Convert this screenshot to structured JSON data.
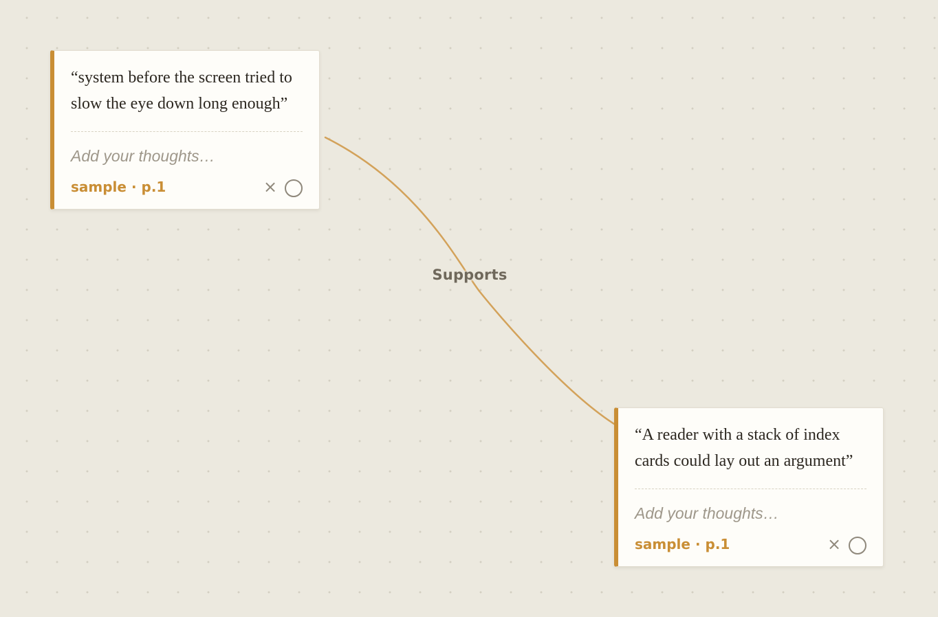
{
  "connection": {
    "label": "Supports",
    "color": "#d3a25a"
  },
  "cards": [
    {
      "quote": "“system before the screen tried to slow the eye down long enough”",
      "thoughts_placeholder": "Add your thoughts…",
      "source": "sample · p.1",
      "close_icon": "×",
      "accent_color": "#c98e35"
    },
    {
      "quote": "“A reader with a stack of index cards could lay out an argument”",
      "thoughts_placeholder": "Add your thoughts…",
      "source": "sample · p.1",
      "close_icon": "×",
      "accent_color": "#c98e35"
    }
  ],
  "icons": {
    "close": "close-icon",
    "link_handle": "circle-icon"
  }
}
